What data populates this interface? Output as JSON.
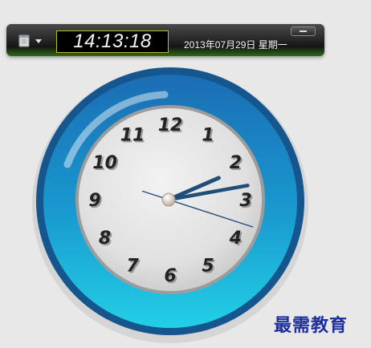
{
  "toolbar": {
    "time": "14:13:18",
    "date": "2013年07月29日  星期一",
    "menu_icon": "document-icon",
    "dropdown_icon": "caret-down-icon",
    "minimize_icon": "minimize-icon"
  },
  "clock": {
    "numerals": [
      "12",
      "1",
      "2",
      "3",
      "4",
      "5",
      "6",
      "7",
      "8",
      "9",
      "10",
      "11"
    ],
    "hours": 14,
    "minutes": 13,
    "seconds": 18,
    "colors": {
      "ring_outer": "#15568e",
      "ring_top": "#1b6db3",
      "ring_bottom": "#22d0e6",
      "face": "#dedede",
      "hands": "#1f4e78"
    }
  },
  "watermark": "最需教育"
}
